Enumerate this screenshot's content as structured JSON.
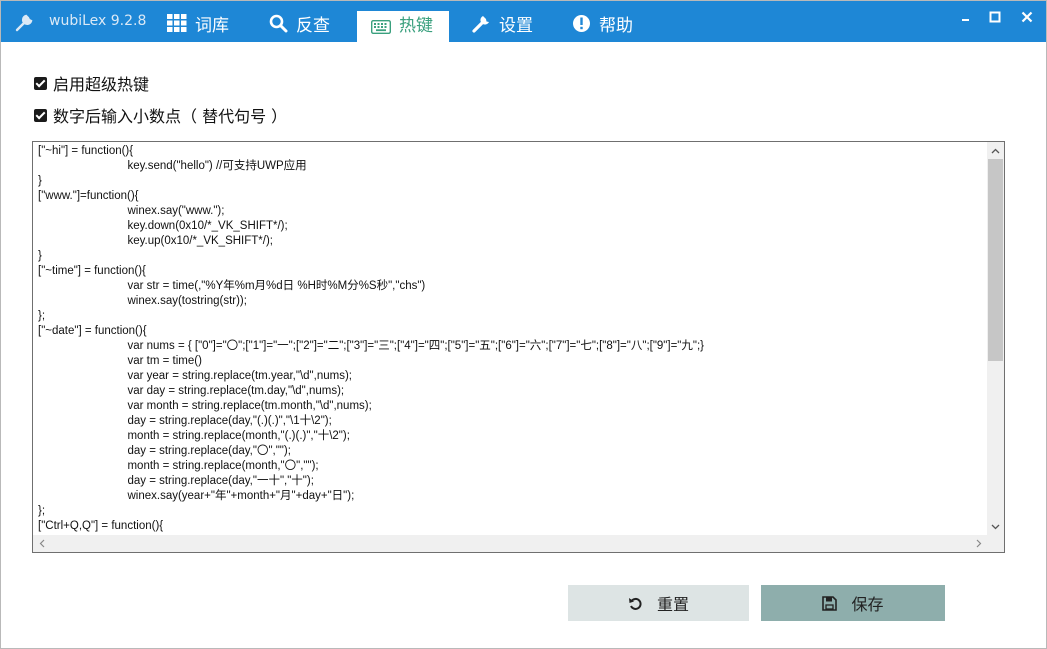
{
  "app": {
    "title": "wubiLex 9.2.8",
    "accent": "#1e87d6",
    "active_tab_color": "#3aa07e"
  },
  "tabs": [
    {
      "label": "词库",
      "icon": "grid-icon"
    },
    {
      "label": "反查",
      "icon": "search-icon"
    },
    {
      "label": "热键",
      "icon": "keyboard-icon",
      "active": true
    },
    {
      "label": "设置",
      "icon": "wrench-icon"
    },
    {
      "label": "帮助",
      "icon": "info-icon"
    }
  ],
  "options": {
    "enable_hotkeys": {
      "label": "启用超级热键",
      "checked": true
    },
    "decimal_point": {
      "label": "数字后输入小数点（ 替代句号 ）",
      "checked": true
    }
  },
  "editor": {
    "lines": [
      "[\"~hi\"] = function(){",
      "\t\tkey.send(\"hello\") //可支持UWP应用",
      "}",
      "[\"www.\"]=function(){",
      "\t\twinex.say(\"www.\");",
      "\t\tkey.down(0x10/*_VK_SHIFT*/);",
      "\t\tkey.up(0x10/*_VK_SHIFT*/);",
      "}",
      "[\"~time\"] = function(){",
      "\t\tvar str = time(,\"%Y年%m月%d日 %H时%M分%S秒\",\"chs\")",
      "\t\twinex.say(tostring(str));",
      "};",
      "[\"~date\"] = function(){",
      "\t\tvar nums = { [\"0\"]=\"〇\";[\"1\"]=\"一\";[\"2\"]=\"二\";[\"3\"]=\"三\";[\"4\"]=\"四\";[\"5\"]=\"五\";[\"6\"]=\"六\";[\"7\"]=\"七\";[\"8\"]=\"八\";[\"9\"]=\"九\";}",
      "\t\tvar tm = time()",
      "\t\tvar year = string.replace(tm.year,\"\\d\",nums);",
      "\t\tvar day = string.replace(tm.day,\"\\d\",nums);",
      "\t\tvar month = string.replace(tm.month,\"\\d\",nums);",
      "\t\tday = string.replace(day,\"(.)(.)\",\"\\1十\\2\");",
      "\t\tmonth = string.replace(month,\"(.)(.)\",\"十\\2\");",
      "\t\tday = string.replace(day,\"〇\",\"\");",
      "\t\tmonth = string.replace(month,\"〇\",\"\");",
      "\t\tday = string.replace(day,\"一十\",\"十\");",
      "\t\twinex.say(year+\"年\"+month+\"月\"+day+\"日\");",
      "};",
      "[\"Ctrl+Q,Q\"] = function(){"
    ]
  },
  "buttons": {
    "reset": {
      "label": "重置",
      "icon": "undo-icon"
    },
    "save": {
      "label": "保存",
      "icon": "floppy-icon"
    }
  }
}
